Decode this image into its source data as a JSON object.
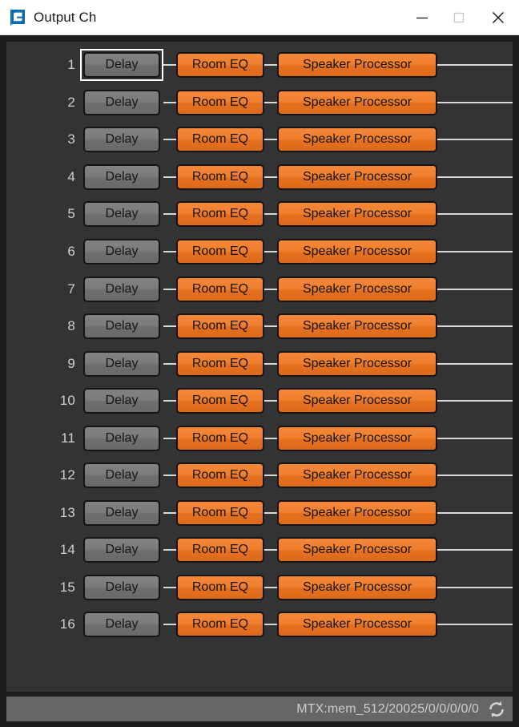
{
  "window": {
    "title": "Output Ch",
    "logo_icon": "e-app-logo-icon",
    "controls": {
      "minimize_icon": "minimize-icon",
      "maximize_icon": "maximize-icon",
      "close_icon": "close-icon"
    }
  },
  "colors": {
    "titlebar_bg": "#ffffff",
    "window_frame": "#1c1c1c",
    "panel_bg": "#333333",
    "accent_orange": "#e8751f",
    "node_gray": "#7a7a7a",
    "connector": "#d8d8d8",
    "focus_ring": "#ffffff",
    "statusbar_bg": "#666666",
    "status_text": "#cccccc",
    "row_number": "#cfcfcf",
    "logo_blue": "#0a6cb4"
  },
  "channels": {
    "count": 16,
    "numbers": [
      "1",
      "2",
      "3",
      "4",
      "5",
      "6",
      "7",
      "8",
      "9",
      "10",
      "11",
      "12",
      "13",
      "14",
      "15",
      "16"
    ],
    "focused_index": 0,
    "nodes": {
      "delay_label": "Delay",
      "room_eq_label": "Room EQ",
      "speaker_processor_label": "Speaker Processor"
    }
  },
  "statusbar": {
    "text": "MTX:mem_512/20025/0/0/0/0/0",
    "sync_icon": "refresh-sync-icon"
  }
}
